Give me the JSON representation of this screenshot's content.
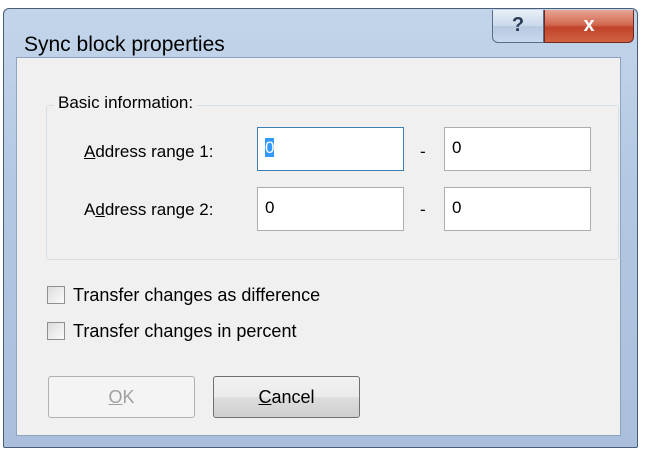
{
  "window": {
    "title": "Sync block properties",
    "help_glyph": "?",
    "close_glyph": "x"
  },
  "group": {
    "label": "Basic information:"
  },
  "rows": [
    {
      "label_pre": "",
      "label_ul": "A",
      "label_post": "ddress range 1:",
      "from": "0",
      "to": "0",
      "dash": "-"
    },
    {
      "label_pre": "A",
      "label_ul": "d",
      "label_post": "dress range 2:",
      "from": "0",
      "to": "0",
      "dash": "-"
    }
  ],
  "checkboxes": [
    {
      "label": "Transfer changes as difference",
      "checked": false
    },
    {
      "label": "Transfer changes in percent",
      "checked": false
    }
  ],
  "buttons": {
    "ok_ul": "O",
    "ok_rest": "K",
    "ok_enabled": false,
    "cancel_ul": "C",
    "cancel_rest": "ancel"
  },
  "colors": {
    "selection": "#3399ff",
    "titlebar": "#b9cde5",
    "close": "#c7452c"
  }
}
